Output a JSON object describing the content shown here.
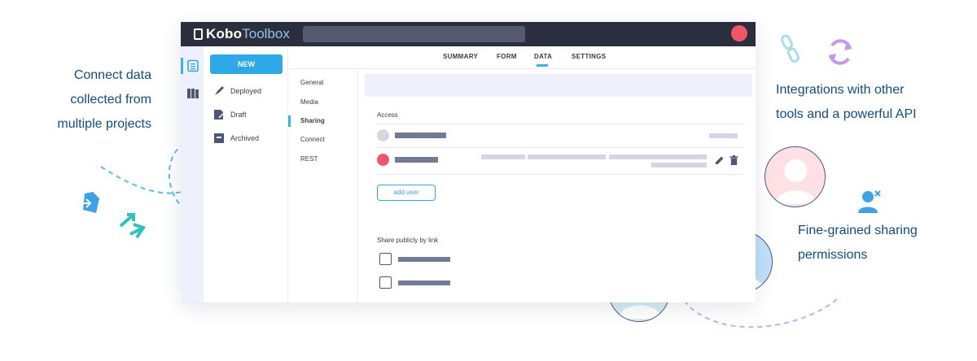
{
  "app": {
    "logo_main": "Kobo",
    "logo_sub": "Toolbox",
    "new_button": "NEW",
    "sidebar_items": [
      {
        "label": "Deployed",
        "icon": "rocket-icon"
      },
      {
        "label": "Draft",
        "icon": "draft-icon"
      },
      {
        "label": "Archived",
        "icon": "archive-icon"
      }
    ],
    "tabs": [
      "SUMMARY",
      "FORM",
      "DATA",
      "SETTINGS"
    ],
    "active_tab": "DATA",
    "subnav": [
      "General",
      "Media",
      "Sharing",
      "Connect",
      "REST"
    ],
    "active_subnav": "Sharing",
    "access_label": "Access",
    "add_user": "add user",
    "share_public_label": "Share publicly by link"
  },
  "callouts": {
    "left": [
      "Connect data",
      "collected from",
      "multiple projects"
    ],
    "right_top": [
      "Integrations with other",
      "tools and a powerful API"
    ],
    "right_bottom": [
      "Fine-grained sharing",
      "permissions"
    ]
  },
  "colors": {
    "accent": "#2ea8e6",
    "topbar": "#2b2e3d",
    "user_red": "#f0566a",
    "text_blue": "#124d80",
    "dashed_blue": "#5bbbea",
    "dashed_purple": "#d4a6ec"
  }
}
